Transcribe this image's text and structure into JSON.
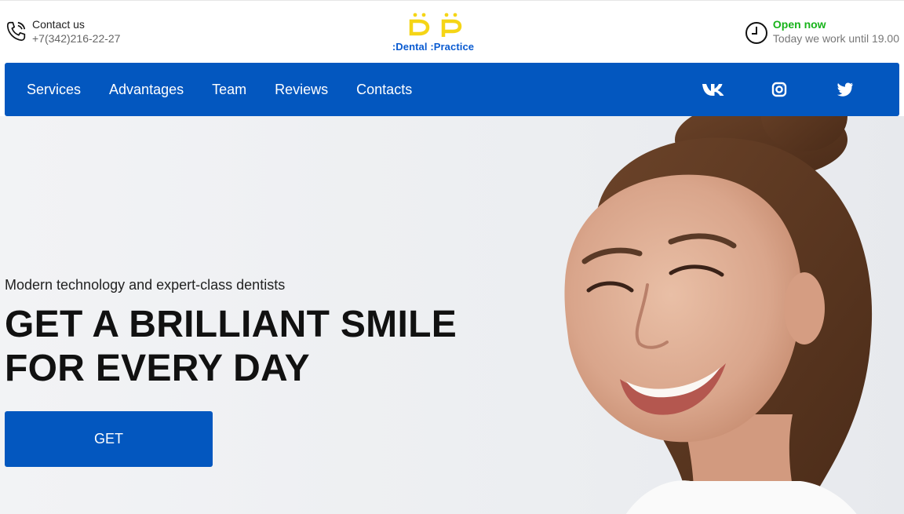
{
  "header": {
    "contact": {
      "label": "Contact us",
      "phone": "+7(342)216-22-27"
    },
    "logo": {
      "name": ":Dental :Practice",
      "mark_color": "#f5d516",
      "text_color": "#0a5bd1"
    },
    "hours": {
      "status": "Open now",
      "until": "Today we work until 19.00",
      "status_color": "#17b31a"
    }
  },
  "nav": {
    "items": [
      {
        "label": "Services"
      },
      {
        "label": "Advantages"
      },
      {
        "label": "Team"
      },
      {
        "label": "Reviews"
      },
      {
        "label": "Contacts"
      }
    ],
    "social": [
      "vk-icon",
      "instagram-icon",
      "twitter-icon"
    ],
    "background": "#0357bf"
  },
  "hero": {
    "subtitle": "Modern technology and expert-class dentists",
    "headline_line1": "GET A BRILLIANT SMILE",
    "headline_line2": "FOR EVERY DAY",
    "cta_label": "GET"
  }
}
